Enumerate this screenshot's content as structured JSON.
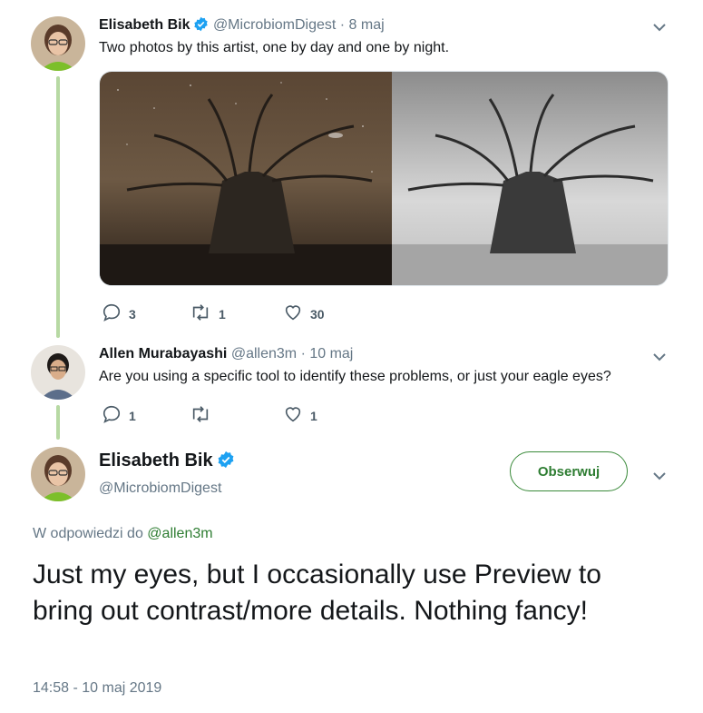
{
  "tweet1": {
    "name": "Elisabeth Bik",
    "handle": "@MicrobiomDigest",
    "time": "· 8 maj",
    "text": "Two photos by this artist, one by day and one by night.",
    "replies": "3",
    "retweets": "1",
    "likes": "30"
  },
  "tweet2": {
    "name": "Allen Murabayashi",
    "handle": "@allen3m",
    "time": "· 10 maj",
    "text": "Are you using a specific tool to identify these problems, or just your eagle eyes?",
    "replies": "1",
    "retweets": "",
    "likes": "1"
  },
  "main_tweet": {
    "name": "Elisabeth Bik",
    "handle": "@MicrobiomDigest",
    "follow_label": "Obserwuj",
    "reply_prefix": "W odpowiedzi do",
    "reply_to": "@allen3m",
    "text": "Just my eyes, but I occasionally use Preview to bring out contrast/more details. Nothing fancy!",
    "timestamp": "14:58 - 10 maj 2019"
  },
  "colors": {
    "accent_green": "#2e7d32",
    "verified_blue": "#1da1f2",
    "thread_line": "#b7d9a3"
  }
}
